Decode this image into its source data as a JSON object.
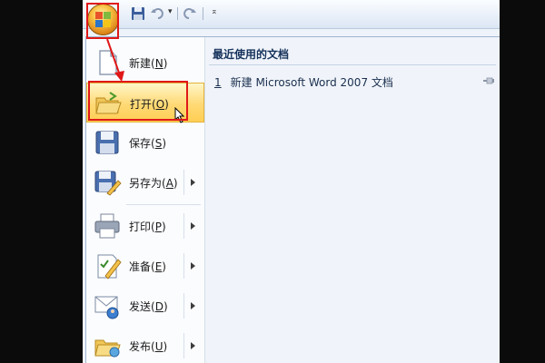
{
  "quick_access": {
    "office_button_label": "Office",
    "save_icon": "save-icon",
    "undo_icon": "undo-icon",
    "redo_icon": "redo-icon",
    "customize_symbol": "⌅"
  },
  "menu": {
    "items": [
      {
        "label": "新建",
        "accel": "N",
        "icon": "new-document-icon",
        "has_submenu": false
      },
      {
        "label": "打开",
        "accel": "O",
        "icon": "open-folder-icon",
        "has_submenu": false,
        "highlighted": true
      },
      {
        "label": "保存",
        "accel": "S",
        "icon": "save-icon",
        "has_submenu": false
      },
      {
        "label": "另存为",
        "accel": "A",
        "icon": "save-as-icon",
        "has_submenu": true
      },
      {
        "label": "打印",
        "accel": "P",
        "icon": "printer-icon",
        "has_submenu": true
      },
      {
        "label": "准备",
        "accel": "E",
        "icon": "prepare-icon",
        "has_submenu": true
      },
      {
        "label": "发送",
        "accel": "D",
        "icon": "send-icon",
        "has_submenu": true
      },
      {
        "label": "发布",
        "accel": "U",
        "icon": "publish-icon",
        "has_submenu": true
      }
    ]
  },
  "recent": {
    "title": "最近使用的文档",
    "documents": [
      {
        "index": "1",
        "name": "新建 Microsoft Word 2007 文档"
      }
    ]
  },
  "colors": {
    "highlight_red": "#e01818",
    "hover_yellow": "#ffd975",
    "title_blue": "#15325b"
  }
}
